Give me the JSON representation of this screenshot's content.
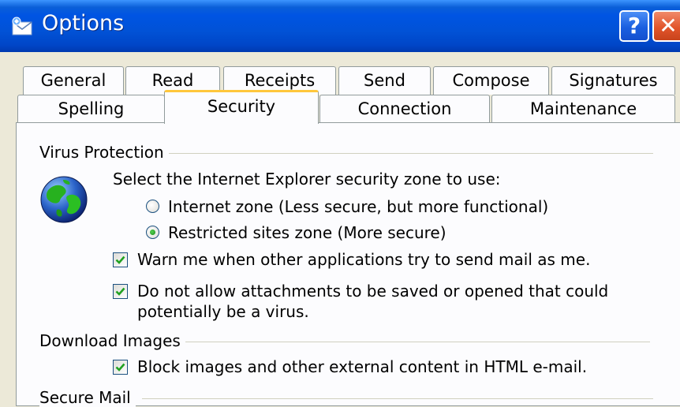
{
  "window": {
    "title": "Options"
  },
  "tabs": {
    "row1": [
      "General",
      "Read",
      "Receipts",
      "Send",
      "Compose",
      "Signatures"
    ],
    "row2": [
      "Spelling",
      "Security",
      "Connection",
      "Maintenance"
    ],
    "active": "Security"
  },
  "virus_protection": {
    "heading": "Virus Protection",
    "zone_prompt": "Select the Internet Explorer security zone to use:",
    "zone_options": [
      {
        "label": "Internet zone (Less secure, but more functional)",
        "selected": false
      },
      {
        "label": "Restricted sites zone (More secure)",
        "selected": true
      }
    ],
    "warn": {
      "label": "Warn me when other applications try to send mail as me.",
      "checked": true
    },
    "attachments": {
      "label_line1": "Do not allow attachments to be saved or opened that could",
      "label_line2": "potentially be a virus.",
      "checked": true
    }
  },
  "download_images": {
    "heading": "Download Images",
    "block": {
      "label": "Block images and other external content in HTML e-mail.",
      "checked": true
    }
  },
  "secure_mail": {
    "heading": "Secure Mail"
  },
  "colors": {
    "titlebar": "#0054e3",
    "active_tab_highlight": "#ffc73c",
    "check_mark": "#21a121",
    "radio_dot": "#2fa42c",
    "window_face": "#ece9d8"
  },
  "icons": {
    "app": "mail-envelope-icon",
    "globe": "globe-icon",
    "help": "help-icon",
    "close": "close-icon"
  },
  "title_buttons": {
    "help": "?",
    "close": "✕"
  }
}
